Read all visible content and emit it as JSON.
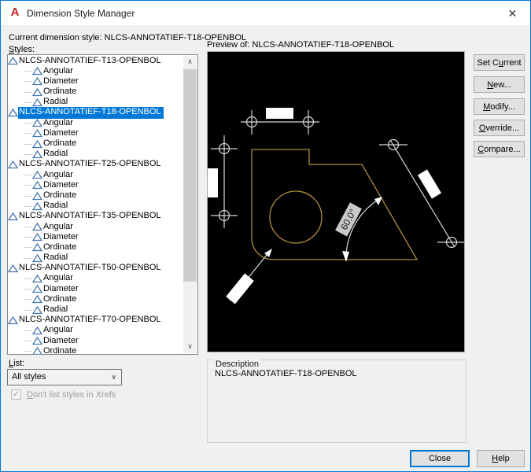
{
  "window": {
    "title": "Dimension Style Manager"
  },
  "icons": {
    "close": "✕",
    "check": "✓",
    "combo_chevron": "∨",
    "scroll_up": "∧",
    "scroll_down": "∨"
  },
  "header": {
    "current_style_label": "Current dimension style:",
    "current_style_value": "NLCS-ANNOTATIEF-T18-OPENBOL"
  },
  "styles_panel": {
    "label": {
      "text": "Styles:",
      "u": "S"
    },
    "selected_style": "NLCS-ANNOTATIEF-T18-OPENBOL",
    "tree": [
      {
        "name": "NLCS-ANNOTATIEF-T13-OPENBOL",
        "selected": false,
        "children": [
          "Angular",
          "Diameter",
          "Ordinate",
          "Radial"
        ]
      },
      {
        "name": "NLCS-ANNOTATIEF-T18-OPENBOL",
        "selected": true,
        "children": [
          "Angular",
          "Diameter",
          "Ordinate",
          "Radial"
        ]
      },
      {
        "name": "NLCS-ANNOTATIEF-T25-OPENBOL",
        "selected": false,
        "children": [
          "Angular",
          "Diameter",
          "Ordinate",
          "Radial"
        ]
      },
      {
        "name": "NLCS-ANNOTATIEF-T35-OPENBOL",
        "selected": false,
        "children": [
          "Angular",
          "Diameter",
          "Ordinate",
          "Radial"
        ]
      },
      {
        "name": "NLCS-ANNOTATIEF-T50-OPENBOL",
        "selected": false,
        "children": [
          "Angular",
          "Diameter",
          "Ordinate",
          "Radial"
        ]
      },
      {
        "name": "NLCS-ANNOTATIEF-T70-OPENBOL",
        "selected": false,
        "children": [
          "Angular",
          "Diameter",
          "Ordinate"
        ]
      }
    ]
  },
  "preview": {
    "label": "Preview of: NLCS-ANNOTATIEF-T18-OPENBOL",
    "angle_text": "60.0°",
    "background": "#000000",
    "shape_color": "#b08d40",
    "dimension_color": "#d9d9d9"
  },
  "side_buttons": [
    {
      "text": "Set Current",
      "u": "u"
    },
    {
      "text": "New...",
      "u": "N"
    },
    {
      "text": "Modify...",
      "u": "M"
    },
    {
      "text": "Override...",
      "u": "O"
    },
    {
      "text": "Compare...",
      "u": "C"
    }
  ],
  "list_filter": {
    "label": {
      "text": "List:",
      "u": "L"
    },
    "value": "All styles",
    "checkbox": {
      "text": "Don't list styles in Xrefs",
      "u": "D"
    },
    "checkbox_checked": true,
    "checkbox_disabled": true
  },
  "description": {
    "label": "Description",
    "text": "NLCS-ANNOTATIEF-T18-OPENBOL"
  },
  "footer": {
    "close": {
      "text": "Close",
      "u": ""
    },
    "help": {
      "text": "Help",
      "u": "H"
    }
  }
}
